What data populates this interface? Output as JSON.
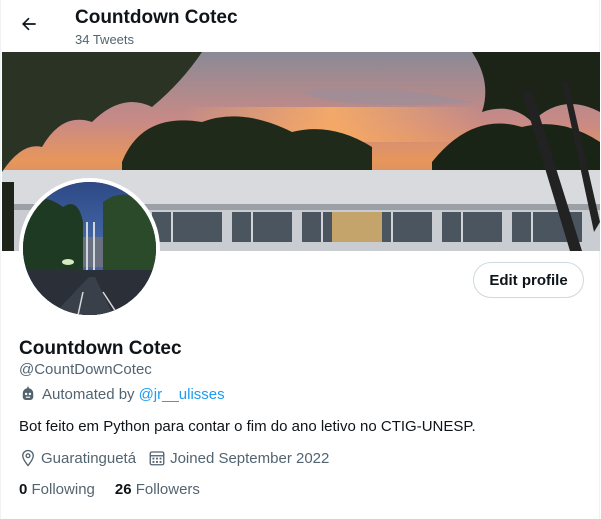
{
  "header": {
    "title": "Countdown Cotec",
    "tweet_count": "34 Tweets"
  },
  "profile": {
    "name": "Countdown Cotec",
    "handle": "@CountDownCotec",
    "automated_prefix": "Automated by",
    "automated_by": "@jr__ulisses",
    "bio": "Bot feito em Python para contar o fim do ano letivo no CTIG-UNESP.",
    "location": "Guaratinguetá",
    "joined": "Joined September 2022",
    "following_count": "0",
    "following_label": "Following",
    "followers_count": "26",
    "followers_label": "Followers",
    "edit_button": "Edit profile"
  },
  "icons": {
    "back": "arrow-left-icon",
    "robot": "robot-icon",
    "location": "location-pin-icon",
    "calendar": "calendar-icon"
  },
  "colors": {
    "accent": "#1d9bf0",
    "text": "#0f1419",
    "muted": "#536471",
    "border": "#cfd9de"
  }
}
